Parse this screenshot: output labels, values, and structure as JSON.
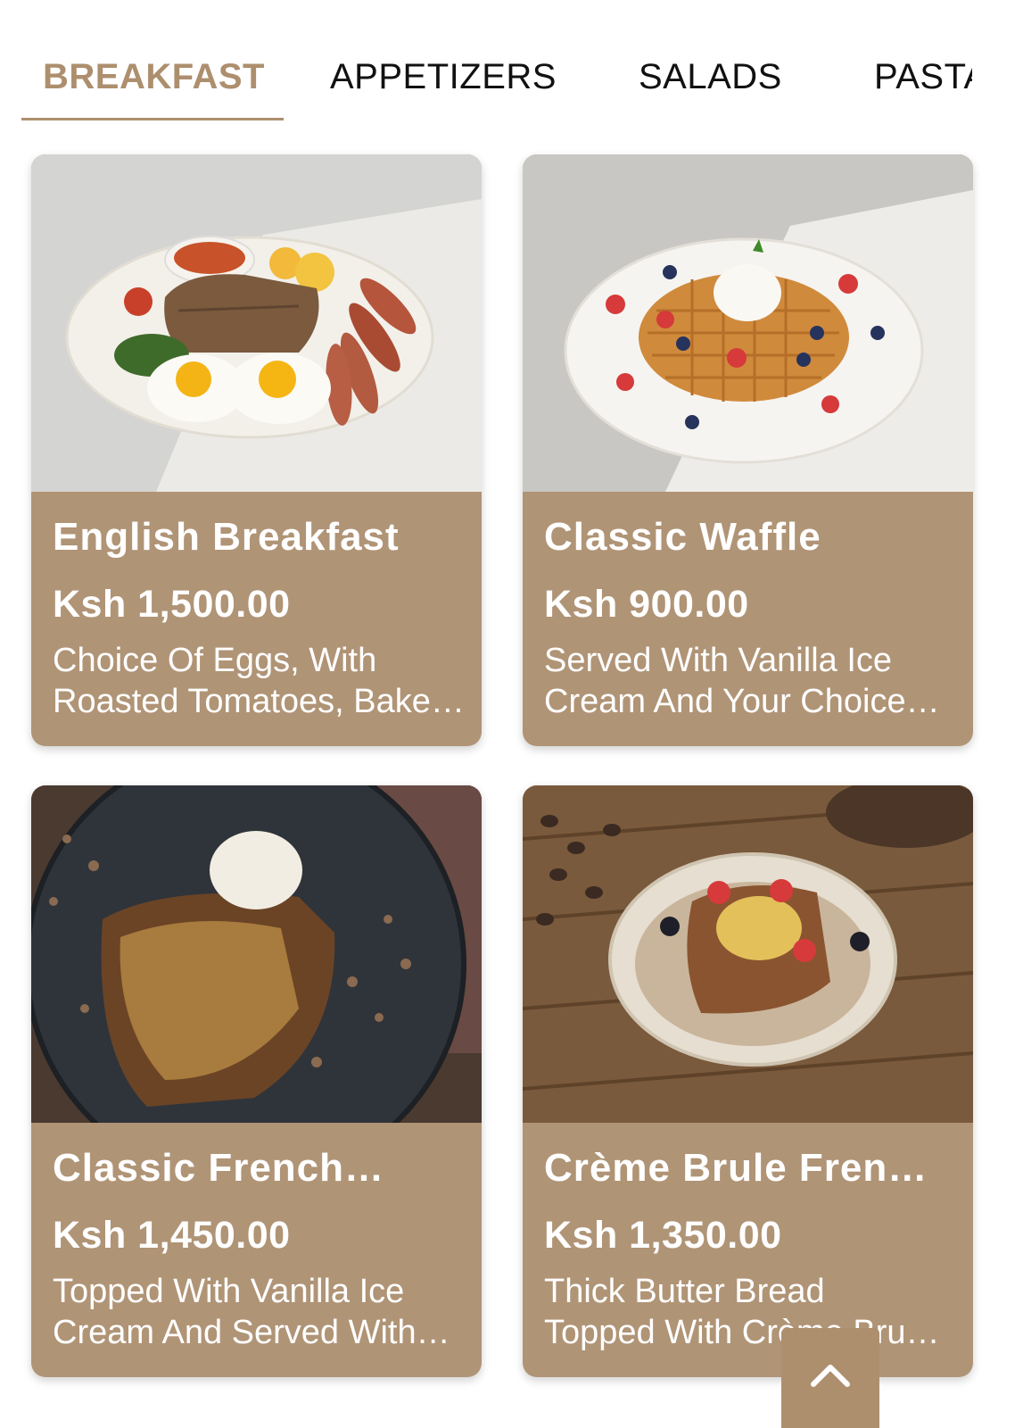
{
  "tabs": [
    {
      "label": "BREAKFAST",
      "active": true
    },
    {
      "label": "APPETIZERS",
      "active": false
    },
    {
      "label": "SALADS",
      "active": false
    },
    {
      "label": "PASTA",
      "active": false
    }
  ],
  "colors": {
    "accent": "#ad8f6e",
    "card_background": "#b09476",
    "card_text": "#ffffff"
  },
  "menu_items": [
    {
      "title": "English Breakfast",
      "price": "Ksh 1,500.00",
      "description": "Choice Of Eggs, With\nRoasted Tomatoes, Bake…"
    },
    {
      "title": "Classic Waffle",
      "price": "Ksh 900.00",
      "description": "Served With Vanilla Ice\nCream And Your Choice…"
    },
    {
      "title": "Classic French…",
      "price": "Ksh 1,450.00",
      "description": "Topped With Vanilla Ice\nCream And Served With…"
    },
    {
      "title": "Crème Brule Fren…",
      "price": "Ksh 1,350.00",
      "description": "Thick Butter Bread\nTopped With Crème Bru…"
    }
  ],
  "scroll_top_icon": "chevron-up-icon"
}
